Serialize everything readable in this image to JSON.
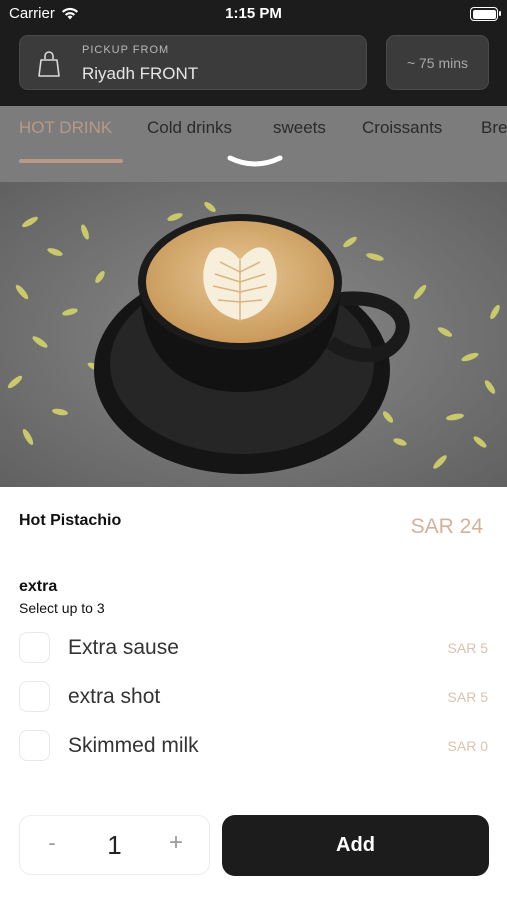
{
  "status_bar": {
    "carrier": "Carrier",
    "time": "1:15 PM"
  },
  "header": {
    "pickup_label": "PICKUP FROM",
    "pickup_value": "Riyadh FRONT",
    "eta": "~ 75 mins"
  },
  "categories": [
    {
      "label": "HOT DRINK",
      "active": true
    },
    {
      "label": "Cold drinks",
      "active": false
    },
    {
      "label": "sweets",
      "active": false
    },
    {
      "label": "Croissants",
      "active": false
    },
    {
      "label": "Bre",
      "active": false
    }
  ],
  "product": {
    "name": "Hot Pistachio",
    "price": "SAR 24"
  },
  "extras": {
    "title": "extra",
    "subtitle": "Select up to 3",
    "options": [
      {
        "name": "Extra sause",
        "price": "SAR 5",
        "checked": false
      },
      {
        "name": "extra shot",
        "price": "SAR 5",
        "checked": false
      },
      {
        "name": "Skimmed milk",
        "price": "SAR 0",
        "checked": false
      }
    ]
  },
  "quantity": {
    "minus": "-",
    "value": "1",
    "plus": "+"
  },
  "add_button": {
    "label": "Add"
  },
  "colors": {
    "accent": "#b79a86",
    "dark": "#1c1c1c",
    "price": "#d3b29a"
  }
}
